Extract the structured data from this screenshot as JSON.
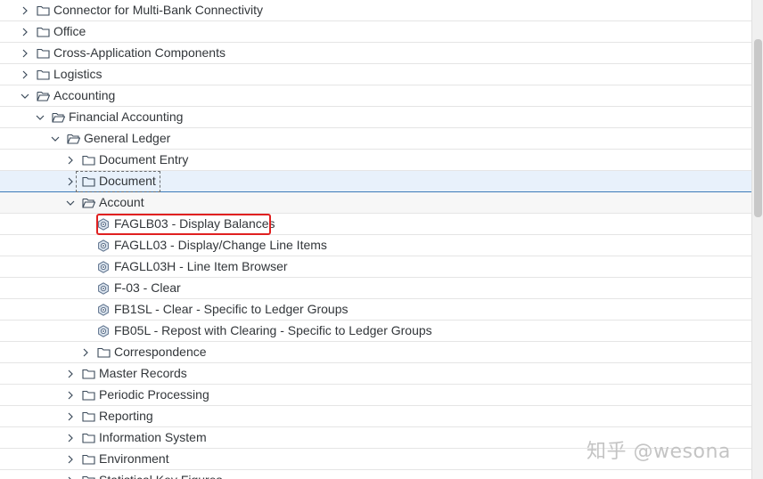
{
  "tree": {
    "rows": [
      {
        "label": "Connector for Multi-Bank Connectivity",
        "kind": "folder",
        "level": 0,
        "expanded": false
      },
      {
        "label": "Office",
        "kind": "folder",
        "level": 0,
        "expanded": false
      },
      {
        "label": "Cross-Application Components",
        "kind": "folder",
        "level": 0,
        "expanded": false
      },
      {
        "label": "Logistics",
        "kind": "folder",
        "level": 0,
        "expanded": false
      },
      {
        "label": "Accounting",
        "kind": "folder",
        "level": 0,
        "expanded": true
      },
      {
        "label": "Financial Accounting",
        "kind": "folder",
        "level": 1,
        "expanded": true
      },
      {
        "label": "General Ledger",
        "kind": "folder",
        "level": 2,
        "expanded": true
      },
      {
        "label": "Document Entry",
        "kind": "folder",
        "level": 3,
        "expanded": false
      },
      {
        "label": "Document",
        "kind": "folder",
        "level": 3,
        "expanded": false,
        "selected": true
      },
      {
        "label": "Account",
        "kind": "folder",
        "level": 3,
        "expanded": true,
        "hover": true
      },
      {
        "label": "FAGLB03 - Display Balances",
        "kind": "transaction",
        "level": 4,
        "highlighted": true
      },
      {
        "label": "FAGLL03 - Display/Change Line Items",
        "kind": "transaction",
        "level": 4
      },
      {
        "label": "FAGLL03H - Line Item Browser",
        "kind": "transaction",
        "level": 4
      },
      {
        "label": "F-03 - Clear",
        "kind": "transaction",
        "level": 4
      },
      {
        "label": "FB1SL - Clear - Specific to Ledger Groups",
        "kind": "transaction",
        "level": 4
      },
      {
        "label": "FB05L - Repost with Clearing - Specific to Ledger Groups",
        "kind": "transaction",
        "level": 4
      },
      {
        "label": "Correspondence",
        "kind": "folder",
        "level": 4,
        "expanded": false
      },
      {
        "label": "Master Records",
        "kind": "folder",
        "level": 3,
        "expanded": false
      },
      {
        "label": "Periodic Processing",
        "kind": "folder",
        "level": 3,
        "expanded": false
      },
      {
        "label": "Reporting",
        "kind": "folder",
        "level": 3,
        "expanded": false
      },
      {
        "label": "Information System",
        "kind": "folder",
        "level": 3,
        "expanded": false
      },
      {
        "label": "Environment",
        "kind": "folder",
        "level": 3,
        "expanded": false
      },
      {
        "label": "Statistical Key Figures",
        "kind": "folder",
        "level": 3,
        "expanded": false
      }
    ]
  },
  "watermark": "知乎 @wesona",
  "colors": {
    "icon": "#3b4a5a",
    "transaction_icon": "#5a6f8a",
    "selected_bg": "#e8f1fb",
    "highlight_border": "#e02020"
  },
  "icons": {
    "folder_closed": "folder-icon",
    "folder_open": "folder-open-icon",
    "transaction": "transaction-icon",
    "chevron_right": "chevron-right-icon",
    "chevron_down": "chevron-down-icon"
  }
}
